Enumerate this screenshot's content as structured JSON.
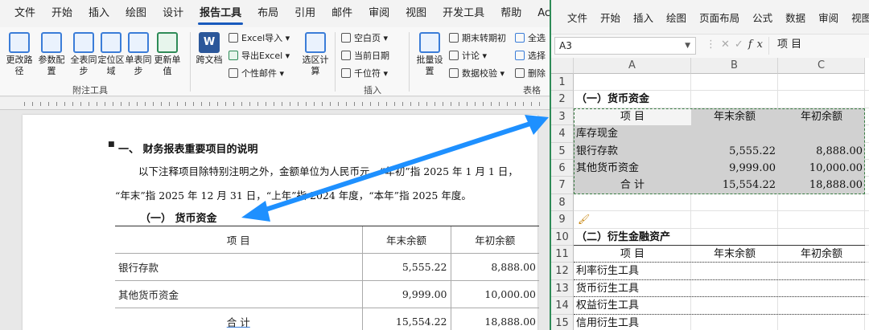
{
  "word": {
    "tabs": [
      "文件",
      "开始",
      "插入",
      "绘图",
      "设计",
      "报告工具",
      "布局",
      "引用",
      "邮件",
      "审阅",
      "视图",
      "开发工具",
      "帮助",
      "Acrobat"
    ],
    "active_tab": "报告工具",
    "ribbon": {
      "btn_change_path": "更改路径",
      "btn_param_config": "参数配置",
      "btn_full_sync": "全表同步",
      "btn_locate_area": "定位区域",
      "btn_single_sync": "单表同步",
      "btn_update_cell": "更新单值",
      "group_annot": "附注工具",
      "btn_cross_doc": "跨文档",
      "small_excel_import": "Excel导入",
      "small_excel_export": "导出Excel",
      "small_personal_mail": "个性邮件",
      "btn_select_calc": "选区计算",
      "small_blank_page": "空白页",
      "small_current_date": "当前日期",
      "small_thousands": "千位符",
      "group_insert": "插入",
      "btn_batch_set": "批量设置",
      "small_period_change": "期末转期初",
      "small_calc": "计论",
      "small_data_check": "数据校验",
      "small_select_all": "全选",
      "small_select": "选择",
      "small_delete": "删除",
      "group_table": "表格"
    },
    "heading": "一、 财务报表重要项目的说明",
    "para1": "以下注释项目除特别注明之外，金额单位为人民币元，“年初”指 2025 年 1 月 1 日，",
    "para2": "“年末”指 2025 年 12 月 31 日，“上年”指 2024 年度，“本年”指 2025 年度。",
    "section_title": "（一）  货币资金",
    "table": {
      "headers": [
        "项      目",
        "年末余额",
        "年初余额"
      ],
      "rows": [
        [
          "银行存款",
          "5,555.22",
          "8,888.00"
        ],
        [
          "其他货币资金",
          "9,999.00",
          "10,000.00"
        ],
        [
          "合    计",
          "15,554.22",
          "18,888.00"
        ]
      ]
    }
  },
  "excel": {
    "tabs": [
      "文件",
      "开始",
      "插入",
      "绘图",
      "页面布局",
      "公式",
      "数据",
      "审阅",
      "视图"
    ],
    "name_box": "A3",
    "formula_value": "项 目",
    "columns": [
      "A",
      "B",
      "C"
    ],
    "row_numbers": [
      "1",
      "2",
      "3",
      "4",
      "5",
      "6",
      "7",
      "8",
      "9",
      "10",
      "11",
      "12",
      "13",
      "14",
      "15"
    ],
    "section1_title": "（一）货币资金",
    "section1_headers": [
      "项 目",
      "年末余额",
      "年初余额"
    ],
    "section1_rows": [
      [
        "库存现金",
        "",
        ""
      ],
      [
        "银行存款",
        "5,555.22",
        "8,888.00"
      ],
      [
        "其他货币资金",
        "9,999.00",
        "10,000.00"
      ],
      [
        "合 计",
        "15,554.22",
        "18,888.00"
      ]
    ],
    "section2_title": "（二）衍生金融资产",
    "section2_headers": [
      "项 目",
      "年末余额",
      "年初余额"
    ],
    "section2_rows": [
      "利率衍生工具",
      "货币衍生工具",
      "权益衍生工具",
      "信用衍生工具"
    ]
  },
  "colors": {
    "accent": "#185abd",
    "excel_green": "#217346",
    "arrow": "#1e90ff",
    "selection": "#d1d1d1"
  }
}
